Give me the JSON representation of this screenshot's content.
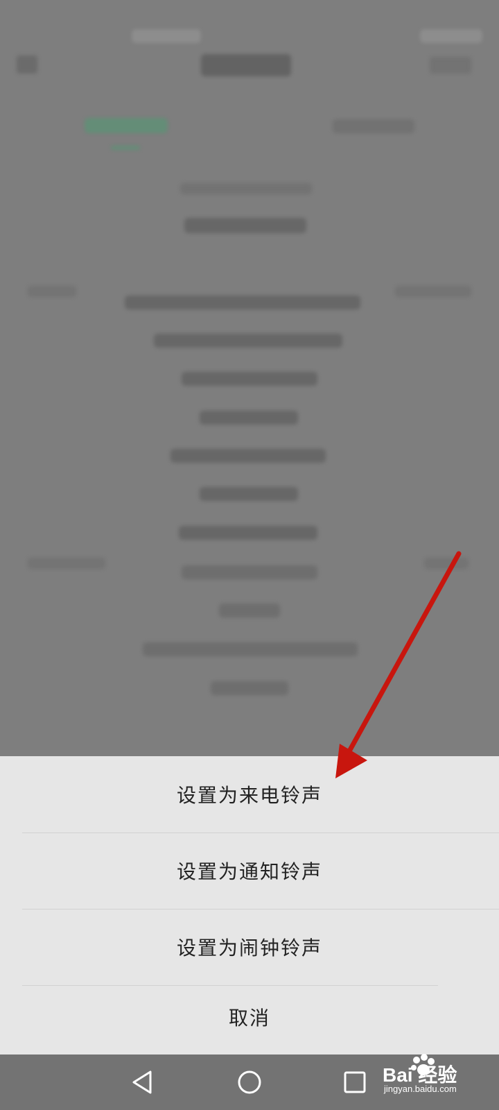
{
  "sheet": {
    "items": [
      {
        "label": "设置为来电铃声"
      },
      {
        "label": "设置为通知铃声"
      },
      {
        "label": "设置为闹钟铃声"
      }
    ],
    "cancel_label": "取消"
  },
  "nav": {
    "back_icon": "triangle-back-icon",
    "home_icon": "circle-home-icon",
    "recents_icon": "square-recents-icon"
  },
  "watermark": {
    "brand": "Bai  经验",
    "url": "jingyan.baidu.com"
  },
  "colors": {
    "sheet_bg": "#e6e6e6",
    "annotation_arrow": "#c8160e",
    "active_tab": "#4f9a72"
  }
}
